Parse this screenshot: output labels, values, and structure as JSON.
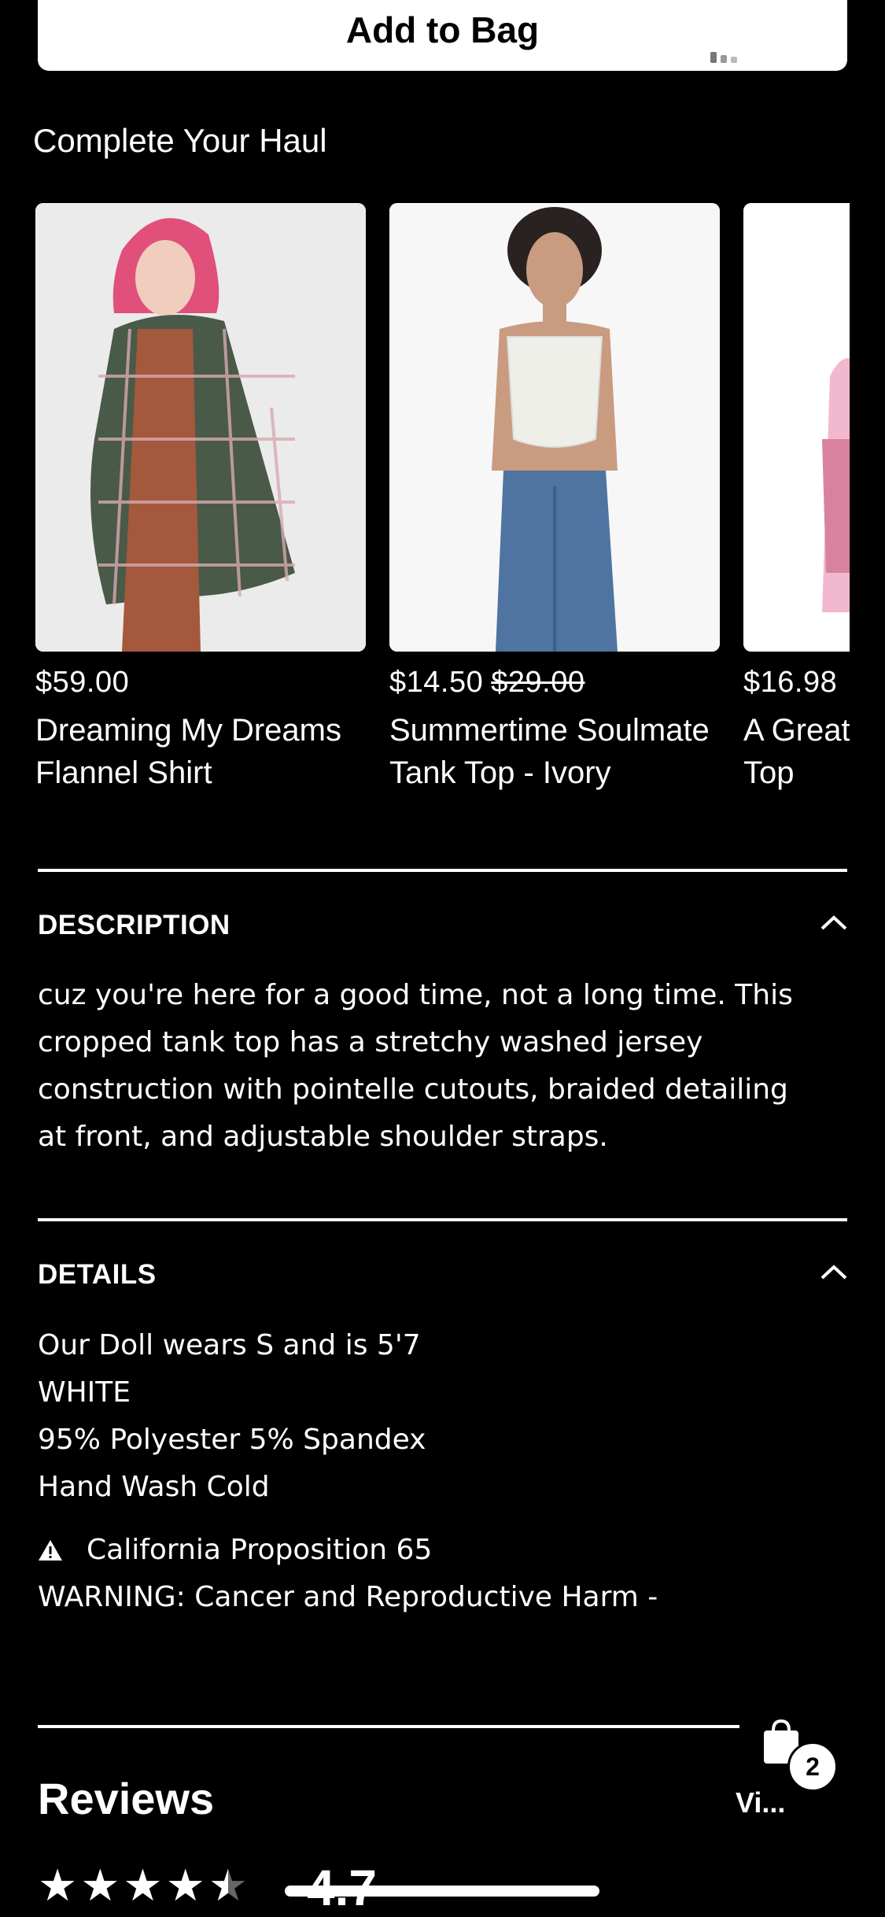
{
  "add_to_bag": {
    "label": "Add to Bag"
  },
  "haul": {
    "title": "Complete Your Haul",
    "products": [
      {
        "price": "$59.00",
        "old_price": "",
        "name_line1": "Dreaming My Dreams",
        "name_line2": "Flannel Shirt"
      },
      {
        "price": "$14.50",
        "old_price": "$29.00",
        "name_line1": "Summertime Soulmate",
        "name_line2": "Tank Top - Ivory"
      },
      {
        "price": "$16.98",
        "old_price": "",
        "name_line1": "A Great",
        "name_line2": "Top"
      }
    ]
  },
  "description": {
    "heading": "DESCRIPTION",
    "lines": [
      "cuz you're here for a good time, not a long time. This",
      "cropped tank top has a stretchy washed jersey",
      "construction with pointelle cutouts, braided detailing",
      "at front, and adjustable shoulder straps."
    ]
  },
  "details": {
    "heading": "DETAILS",
    "lines": [
      "Our Doll wears S and is 5'7",
      "WHITE",
      "95% Polyester 5% Spandex",
      "Hand Wash Cold"
    ],
    "prop65_title": "California Proposition 65",
    "prop65_warning": "WARNING: Cancer and Reproductive Harm -"
  },
  "bag": {
    "count": "2"
  },
  "reviews": {
    "title": "Reviews",
    "view_all": "Vi...",
    "rating": "4.7",
    "stars": 4.5
  }
}
